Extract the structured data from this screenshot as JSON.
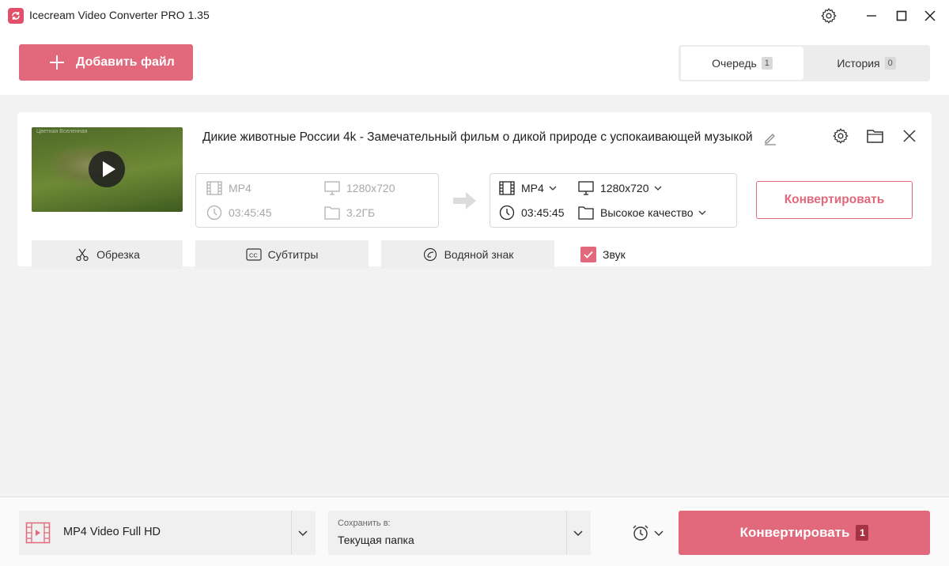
{
  "window": {
    "title": "Icecream Video Converter PRO 1.35"
  },
  "header": {
    "add_file_label": "Добавить файл",
    "tabs": [
      {
        "label": "Очередь",
        "count": "1"
      },
      {
        "label": "История",
        "count": "0"
      }
    ]
  },
  "item": {
    "filename": "Дикие животные России 4k - Замечательный фильм о дикой природе с успокаивающей музыкой",
    "thumbnail_watermark": "Цветная Вселенная",
    "source": {
      "format": "MP4",
      "resolution": "1280x720",
      "duration": "03:45:45",
      "size": "3.2ГБ"
    },
    "target": {
      "format": "MP4",
      "resolution": "1280x720",
      "duration": "03:45:45",
      "quality": "Высокое качество"
    },
    "convert_label": "Конвертировать",
    "tools": {
      "trim": "Обрезка",
      "subtitles": "Субтитры",
      "watermark": "Водяной знак",
      "sound": "Звук"
    },
    "sound_checked": true
  },
  "footer": {
    "preset": "MP4 Video Full HD",
    "save_to_label": "Сохранить в:",
    "save_to_value": "Текущая папка",
    "convert_label": "Конвертировать",
    "convert_count": "1"
  },
  "colors": {
    "accent": "#e2687b",
    "background": "#f2f2f2"
  },
  "icons": [
    "app-logo-icon",
    "settings-icon",
    "minimize-icon",
    "maximize-icon",
    "close-icon",
    "plus-icon",
    "play-icon",
    "edit-icon",
    "folder-icon",
    "film-icon",
    "monitor-icon",
    "clock-icon",
    "scissors-icon",
    "cc-icon",
    "watermark-icon",
    "check-icon",
    "chevron-down-icon",
    "alarm-icon",
    "arrow-right-icon"
  ]
}
